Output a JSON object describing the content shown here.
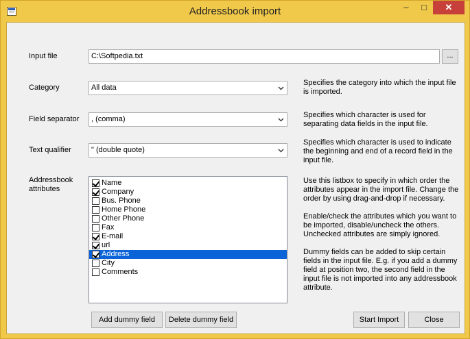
{
  "window": {
    "title": "Addressbook import",
    "controls": {
      "minimize": "–",
      "maximize": "□",
      "close": "✕"
    }
  },
  "form": {
    "input_file": {
      "label": "Input file",
      "value": "C:\\Softpedia.txt",
      "browse": "..."
    },
    "category": {
      "label": "Category",
      "value": "All data",
      "description": "Specifies the category into which the input file is imported."
    },
    "field_separator": {
      "label": "Field separator",
      "value": ", (comma)",
      "description": "Specifies which character is used for separating data fields in the input file."
    },
    "text_qualifier": {
      "label": "Text qualifier",
      "value": "\" (double quote)",
      "description": "Specifies which character is used to indicate the beginning and end of a record field in the input file."
    },
    "attributes": {
      "label": "Addressbook attributes",
      "items": [
        {
          "label": "Name",
          "checked": true,
          "selected": false
        },
        {
          "label": "Company",
          "checked": true,
          "selected": false
        },
        {
          "label": "Bus. Phone",
          "checked": false,
          "selected": false
        },
        {
          "label": "Home Phone",
          "checked": false,
          "selected": false
        },
        {
          "label": "Other Phone",
          "checked": false,
          "selected": false
        },
        {
          "label": "Fax",
          "checked": false,
          "selected": false
        },
        {
          "label": "E-mail",
          "checked": true,
          "selected": false
        },
        {
          "label": "url",
          "checked": true,
          "selected": false
        },
        {
          "label": "Address",
          "checked": true,
          "selected": true
        },
        {
          "label": "City",
          "checked": false,
          "selected": false
        },
        {
          "label": "Comments",
          "checked": false,
          "selected": false
        }
      ],
      "description_1": "Use this listbox to specify in which order the attributes appear in the import file. Change the order by using drag-and-drop if necessary.",
      "description_2": "Enable/check the attributes which you want to be imported, disable/uncheck the others. Unchecked attributes are simply ignored.",
      "description_3": "Dummy fields can be added to skip certain fields in the input file. E.g. if you add a dummy field at position two, the second field in the input file is not imported into any addressbook attribute."
    }
  },
  "buttons": {
    "add_dummy": "Add dummy field",
    "delete_dummy": "Delete dummy field",
    "start_import": "Start Import",
    "close": "Close"
  },
  "colors": {
    "frame": "#f0c84a",
    "selection": "#0a64d8",
    "close": "#c7413a"
  }
}
